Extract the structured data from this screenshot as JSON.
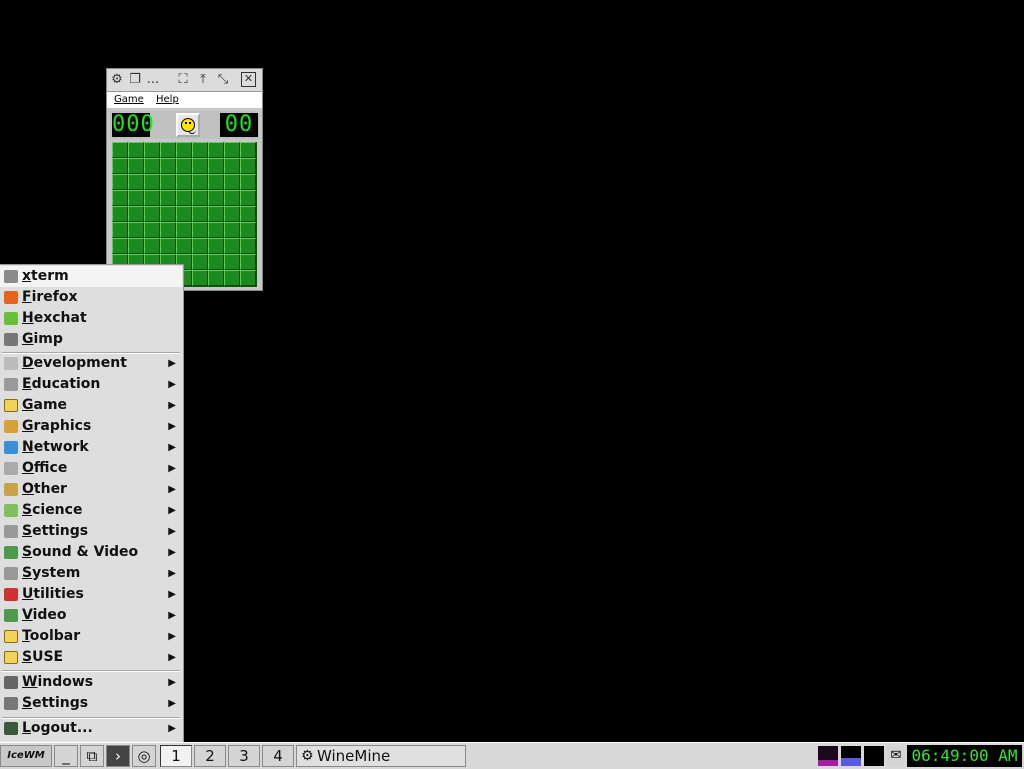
{
  "window": {
    "title_icons": [
      "gear-icon",
      "restore-icon",
      "more-icon",
      "maximize-icon",
      "raise-icon",
      "minimize-icon",
      "close-icon"
    ],
    "more_text": "...",
    "menu": {
      "game": "Game",
      "help": "Help"
    },
    "mine_counter": "000",
    "timer": "00",
    "grid": {
      "rows": 9,
      "cols": 9
    }
  },
  "start_menu": {
    "top_items": [
      {
        "label": "xterm",
        "icon": "terminal-icon"
      },
      {
        "label": "Firefox",
        "icon": "firefox-icon"
      },
      {
        "label": "Hexchat",
        "icon": "hexchat-icon"
      },
      {
        "label": "Gimp",
        "icon": "gimp-icon"
      }
    ],
    "categories": [
      {
        "label": "Development",
        "icon": "development-icon"
      },
      {
        "label": "Education",
        "icon": "education-icon"
      },
      {
        "label": "Game",
        "icon": "folder-icon"
      },
      {
        "label": "Graphics",
        "icon": "graphics-icon"
      },
      {
        "label": "Network",
        "icon": "network-icon"
      },
      {
        "label": "Office",
        "icon": "office-icon"
      },
      {
        "label": "Other",
        "icon": "other-icon"
      },
      {
        "label": "Science",
        "icon": "science-icon"
      },
      {
        "label": "Settings",
        "icon": "settings-gear-icon"
      },
      {
        "label": "Sound & Video",
        "icon": "sound-video-icon"
      },
      {
        "label": "System",
        "icon": "system-gear-icon"
      },
      {
        "label": "Utilities",
        "icon": "utilities-icon"
      },
      {
        "label": "Video",
        "icon": "video-icon"
      },
      {
        "label": "Toolbar",
        "icon": "folder-icon"
      },
      {
        "label": "SUSE",
        "icon": "folder-icon"
      }
    ],
    "bottom_items": [
      {
        "label": "Windows",
        "icon": "windows-icon"
      },
      {
        "label": "Settings",
        "icon": "wrench-icon"
      }
    ],
    "logout": {
      "label": "Logout...",
      "icon": "logout-icon"
    }
  },
  "taskbar": {
    "start_label": "IceWM",
    "workspaces": [
      "1",
      "2",
      "3",
      "4"
    ],
    "active_workspace": "1",
    "task_winemine": "WineMine",
    "clock": "06:49:00 AM"
  },
  "colors": {
    "lcd": "#19e619",
    "cell": "#1c8a1c",
    "menu_bg": "#dedede",
    "clock_text": "#2de62d"
  }
}
